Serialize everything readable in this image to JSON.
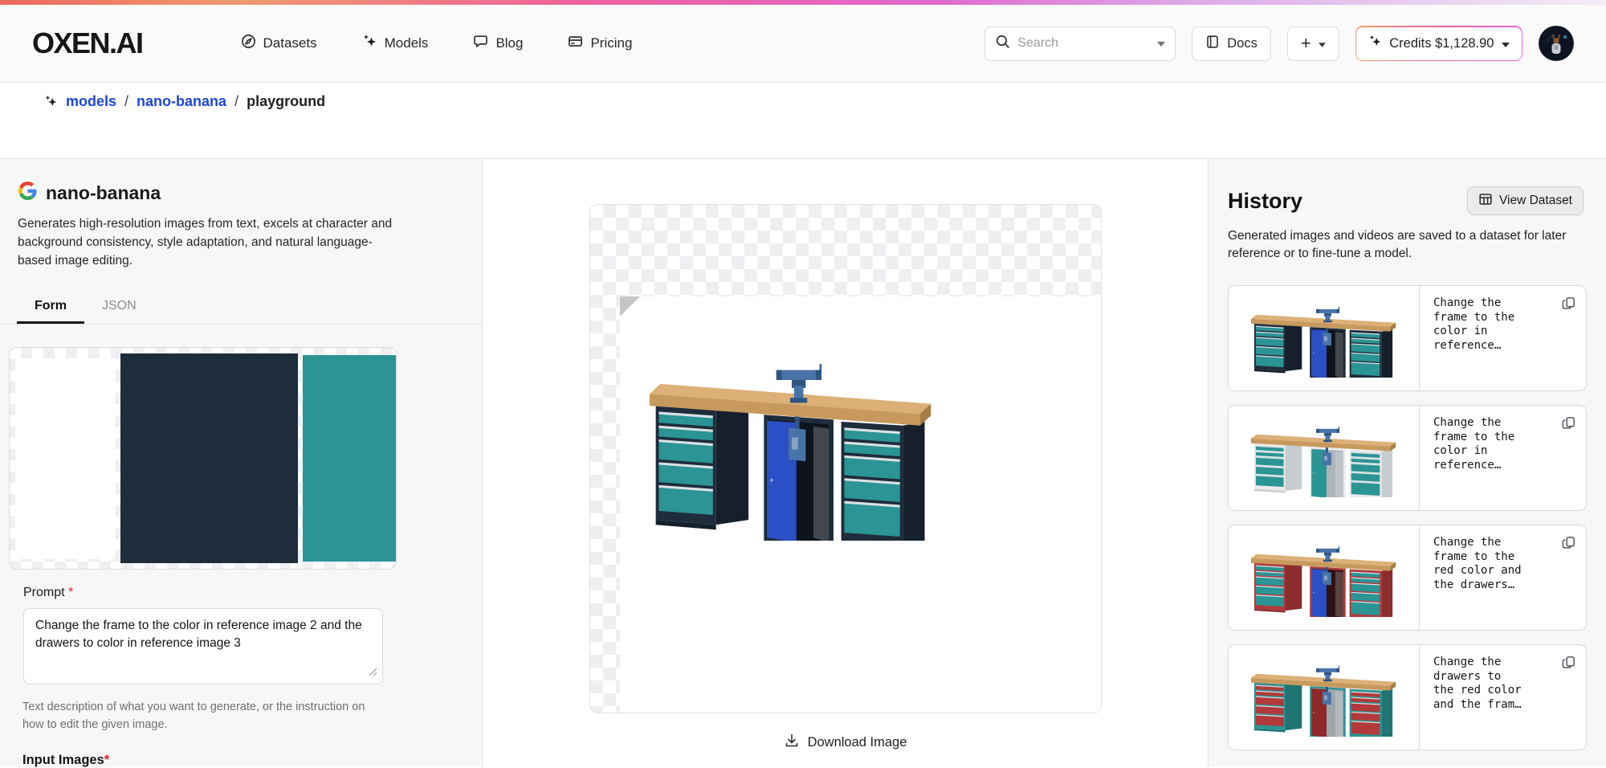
{
  "colors": {
    "accent_link": "#1d46d8",
    "required": "#e02424",
    "g1": "#ed6a5e",
    "g2": "#f29a6e",
    "g3": "#ef639c",
    "g4": "#e168cf",
    "g5": "#ddafe9",
    "g6": "#f3edf6",
    "wood_top": "#ddb078",
    "wood": "#c8995d",
    "wood_dark": "#a57e45",
    "vise": "#4873a8",
    "vise_dark": "#2f5580",
    "handle": "#dbe0e5"
  },
  "navbar": {
    "logo": "OXEN.AI",
    "links": [
      {
        "label": "Datasets",
        "icon": "compass-icon"
      },
      {
        "label": "Models",
        "icon": "sparkles-icon"
      },
      {
        "label": "Blog",
        "icon": "chat-bubble-icon"
      },
      {
        "label": "Pricing",
        "icon": "credit-card-icon"
      }
    ],
    "search_placeholder": "Search",
    "docs_label": "Docs",
    "plus_label": "+",
    "credits_label": "Credits $1,128.90"
  },
  "breadcrumb": {
    "separator": "/",
    "parts": [
      {
        "label": "models"
      },
      {
        "label": "nano-banana"
      },
      {
        "label": "playground"
      }
    ]
  },
  "model_panel": {
    "title": "nano-banana",
    "description": "Generates high-resolution images from text, excels at character and background consistency, style adaptation, and natural language-based image editing.",
    "tabs": [
      {
        "label": "Form"
      },
      {
        "label": "JSON"
      }
    ],
    "input_images": [
      {
        "kind": "image",
        "name": "workbench-reference",
        "colors": {
          "frame": "#eceef0",
          "frame_side": "#ced3d7",
          "drawers": "#2b57c8",
          "door": "#2b57c8",
          "interior": "#c3c8cc"
        }
      },
      {
        "kind": "color",
        "value": "#1e2c3b"
      },
      {
        "kind": "color",
        "value": "#2b9494"
      }
    ],
    "prompt_label": "Prompt",
    "required_mark": "*",
    "prompt_value": "Change the frame to the color in reference image 2 and the drawers to color in reference image 3",
    "prompt_help": "Text description of what you want to generate, or the instruction on how to edit the given image.",
    "input_images_label": "Input Images"
  },
  "viewer": {
    "download_label": "Download Image",
    "image_name": "generated-workbench",
    "colors": {
      "frame": "#1e2c3b",
      "frame_side": "#15202c",
      "drawers": "#2b9494",
      "door": "#2b4fc4",
      "interior": "#0d141b"
    }
  },
  "history": {
    "title": "History",
    "view_dataset_label": "View Dataset",
    "description": "Generated images and videos are saved to a dataset for later reference or to fine-tune a model.",
    "items": [
      {
        "prompt": "Change the frame to the color in reference…",
        "colors": {
          "frame": "#1e2c3b",
          "frame_side": "#15202c",
          "drawers": "#2b9494",
          "door": "#2b4fc4",
          "interior": "#0d141b"
        }
      },
      {
        "prompt": "Change the frame to the color in reference…",
        "colors": {
          "frame": "#e9ebed",
          "frame_side": "#c9cdd1",
          "drawers": "#2b9494",
          "door": "#2b9494",
          "interior": "#aeb4b8"
        }
      },
      {
        "prompt": "Change the frame to the red color and the drawers…",
        "colors": {
          "frame": "#b23a3a",
          "frame_side": "#8c2c2c",
          "drawers": "#2b9494",
          "door": "#2b4fc4",
          "interior": "#301010"
        }
      },
      {
        "prompt": "Change the drawers to the red color and the fram…",
        "colors": {
          "frame": "#2b9494",
          "frame_side": "#207474",
          "drawers": "#b23a3a",
          "door": "#8f2828",
          "interior": "#9fa6aa"
        }
      }
    ]
  }
}
